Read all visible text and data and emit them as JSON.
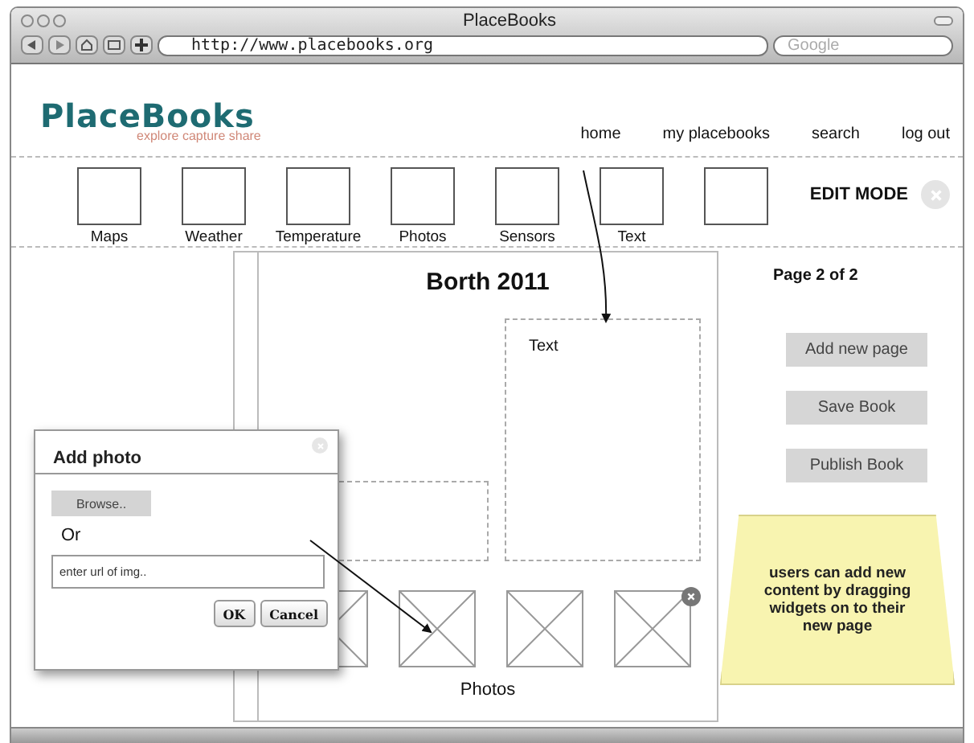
{
  "window": {
    "title": "PlaceBooks"
  },
  "browser": {
    "url": "http://www.placebooks.org",
    "search_placeholder": "Google"
  },
  "site": {
    "logo": "PlaceBooks",
    "tagline": "explore capture share",
    "nav": [
      "home",
      "my placebooks",
      "search",
      "log out"
    ]
  },
  "palette": {
    "widgets": [
      {
        "kind": "widget",
        "label": "Maps"
      },
      {
        "kind": "widget",
        "label": "Weather"
      },
      {
        "kind": "widget",
        "label": "Temperature"
      },
      {
        "kind": "widget",
        "label": "Photos"
      },
      {
        "kind": "widget",
        "label": "Sensors"
      },
      {
        "kind": "widget",
        "label": "Text"
      },
      {
        "kind": "empty"
      }
    ],
    "mode": "EDIT MODE"
  },
  "book": {
    "title": "Borth 2011",
    "page": "Page 2 of 2",
    "text_widget": "Text",
    "photos": {
      "label": "Photos",
      "items": [
        {
          "removable": false
        },
        {
          "removable": false
        },
        {
          "removable": false
        },
        {
          "removable": true
        }
      ]
    }
  },
  "actions": [
    "Add new page",
    "Save Book",
    "Publish Book"
  ],
  "note": "users can add new content by dragging widgets on to their new page",
  "dialog": {
    "title": "Add photo",
    "browse": "Browse..",
    "or": "Or",
    "url_placeholder": "enter url of img..",
    "buttons": [
      "OK",
      "Cancel"
    ]
  }
}
